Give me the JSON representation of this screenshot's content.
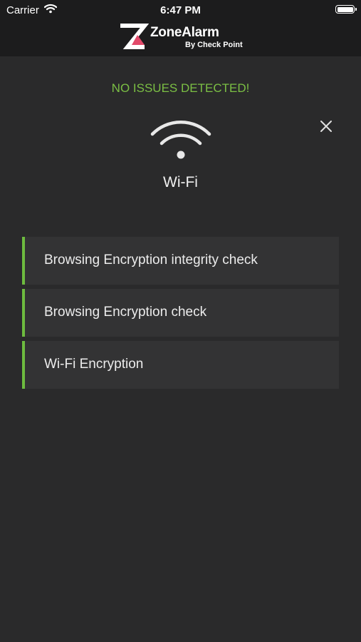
{
  "status_bar": {
    "carrier": "Carrier",
    "time": "6:47 PM"
  },
  "brand": {
    "name": "ZoneAlarm",
    "sub": "By Check Point"
  },
  "scan": {
    "status": "NO ISSUES DETECTED!",
    "category": "Wi-Fi",
    "status_color": "#7bbf44"
  },
  "checks": [
    {
      "label": "Browsing Encryption integrity check"
    },
    {
      "label": "Browsing Encryption check"
    },
    {
      "label": "Wi-Fi Encryption"
    }
  ],
  "icons": {
    "close": "close-icon",
    "wifi": "wifi-icon"
  }
}
